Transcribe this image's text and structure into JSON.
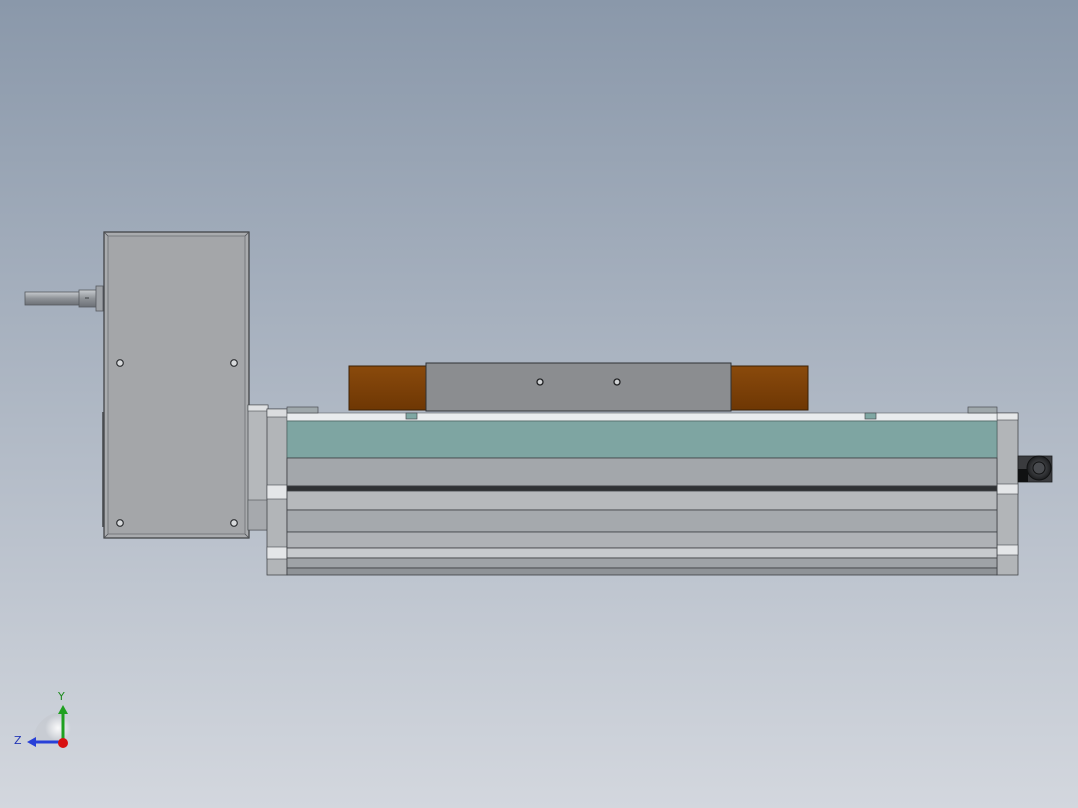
{
  "viewport": {
    "background_top": "#8a98aa",
    "background_bottom": "#d3d7de"
  },
  "model": {
    "components": [
      {
        "name": "motor-housing",
        "color": "#a9abae"
      },
      {
        "name": "motor-shaft",
        "color": "#9fa3a8"
      },
      {
        "name": "rail-body",
        "color": "#a3a7ab"
      },
      {
        "name": "rail-top-cover",
        "color": "#7ea5a2"
      },
      {
        "name": "carriage-plate",
        "color": "#8b8d90"
      },
      {
        "name": "carriage-end-block",
        "color": "#7a3f06"
      },
      {
        "name": "end-cap-connector",
        "color": "#2e2f31"
      }
    ]
  },
  "triad": {
    "y_label": "Y",
    "z_label": "Z",
    "y_color": "#1fa020",
    "z_color": "#2840d8",
    "origin_color": "#d81010"
  }
}
